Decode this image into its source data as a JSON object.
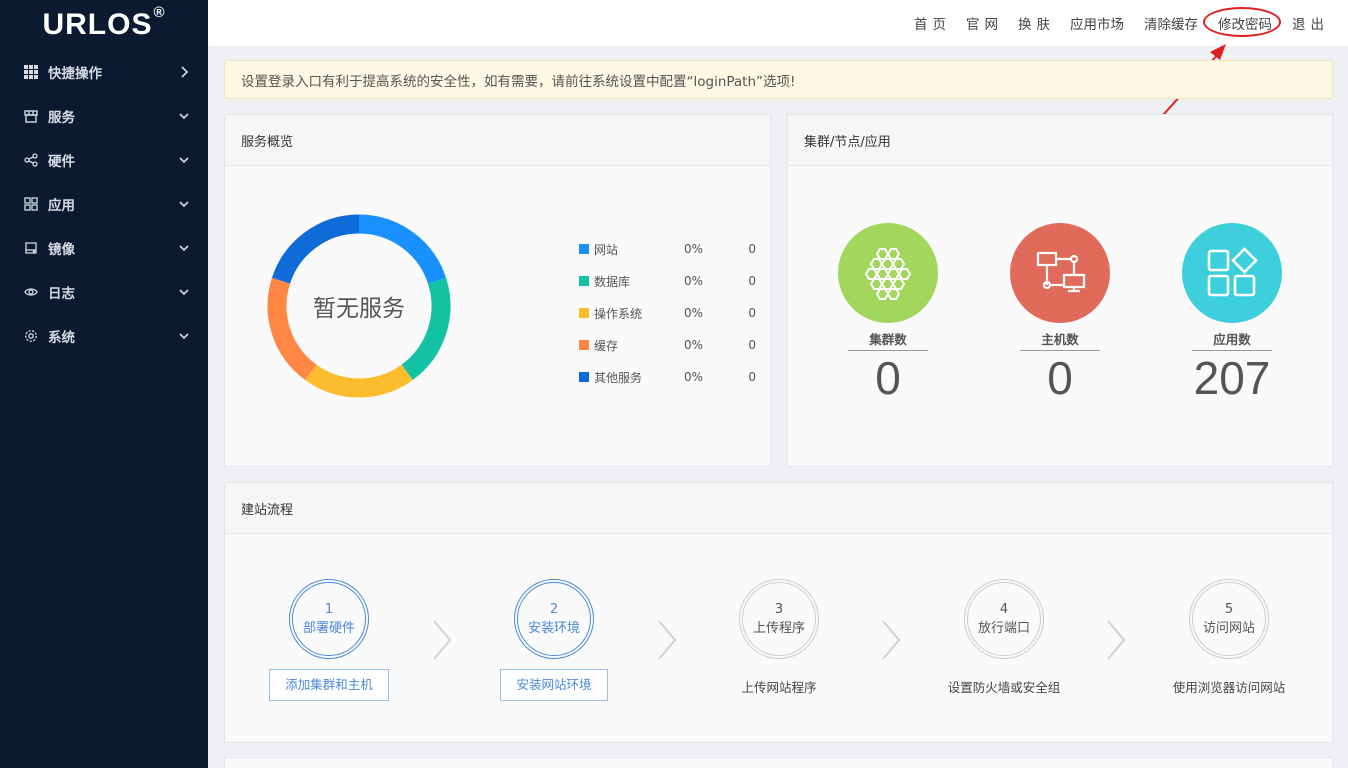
{
  "brand": {
    "name": "URLOS",
    "mark": "®"
  },
  "sidebar": {
    "items": [
      {
        "label": "快捷操作",
        "icon": "grid-icon",
        "chevron": "right"
      },
      {
        "label": "服务",
        "icon": "store-icon",
        "chevron": "down"
      },
      {
        "label": "硬件",
        "icon": "share-nodes-icon",
        "chevron": "down"
      },
      {
        "label": "应用",
        "icon": "apps-icon",
        "chevron": "down"
      },
      {
        "label": "镜像",
        "icon": "drive-icon",
        "chevron": "down"
      },
      {
        "label": "日志",
        "icon": "eye-icon",
        "chevron": "down"
      },
      {
        "label": "系统",
        "icon": "gear-icon",
        "chevron": "down"
      }
    ]
  },
  "topnav": {
    "home": "首页",
    "official": "官网",
    "skin": "换肤",
    "market": "应用市场",
    "clear_cache": "清除缓存",
    "change_password": "修改密码",
    "logout": "退出"
  },
  "notice": "设置登录入口有利于提高系统的安全性，如有需要，请前往系统设置中配置“loginPath”选项!",
  "service_panel": {
    "title": "服务概览",
    "center_text": "暂无服务",
    "legend": [
      {
        "name": "网站",
        "pct": "0%",
        "count": "0",
        "color": "#1890ff"
      },
      {
        "name": "数据库",
        "pct": "0%",
        "count": "0",
        "color": "#13c2a3"
      },
      {
        "name": "操作系统",
        "pct": "0%",
        "count": "0",
        "color": "#fbbc2e"
      },
      {
        "name": "缓存",
        "pct": "0%",
        "count": "0",
        "color": "#ff8743"
      },
      {
        "name": "其他服务",
        "pct": "0%",
        "count": "0",
        "color": "#0f6bd8"
      }
    ],
    "ring_colors": [
      "#1890ff",
      "#13c2a3",
      "#fbbc2e",
      "#ff8743",
      "#0f6bd8"
    ]
  },
  "cluster_panel": {
    "title": "集群/节点/应用",
    "stats": [
      {
        "label": "集群数",
        "value": "0",
        "color": "#a3d65c",
        "icon": "hexagon-cluster-icon"
      },
      {
        "label": "主机数",
        "value": "0",
        "color": "#e06b5a",
        "icon": "host-network-icon"
      },
      {
        "label": "应用数",
        "value": "207",
        "color": "#3ecfdc",
        "icon": "apps-grid-icon"
      }
    ]
  },
  "flow_panel": {
    "title": "建站流程",
    "steps": [
      {
        "num": "1",
        "title": "部署硬件",
        "action": "添加集群和主机",
        "active": true
      },
      {
        "num": "2",
        "title": "安装环境",
        "action": "安装网站环境",
        "active": true
      },
      {
        "num": "3",
        "title": "上传程序",
        "caption": "上传网站程序",
        "active": false
      },
      {
        "num": "4",
        "title": "放行端口",
        "caption": "设置防火墙或安全组",
        "active": false
      },
      {
        "num": "5",
        "title": "访问网站",
        "caption": "使用浏览器访问网站",
        "active": false
      }
    ]
  },
  "annotation": {
    "color": "#e02020"
  }
}
